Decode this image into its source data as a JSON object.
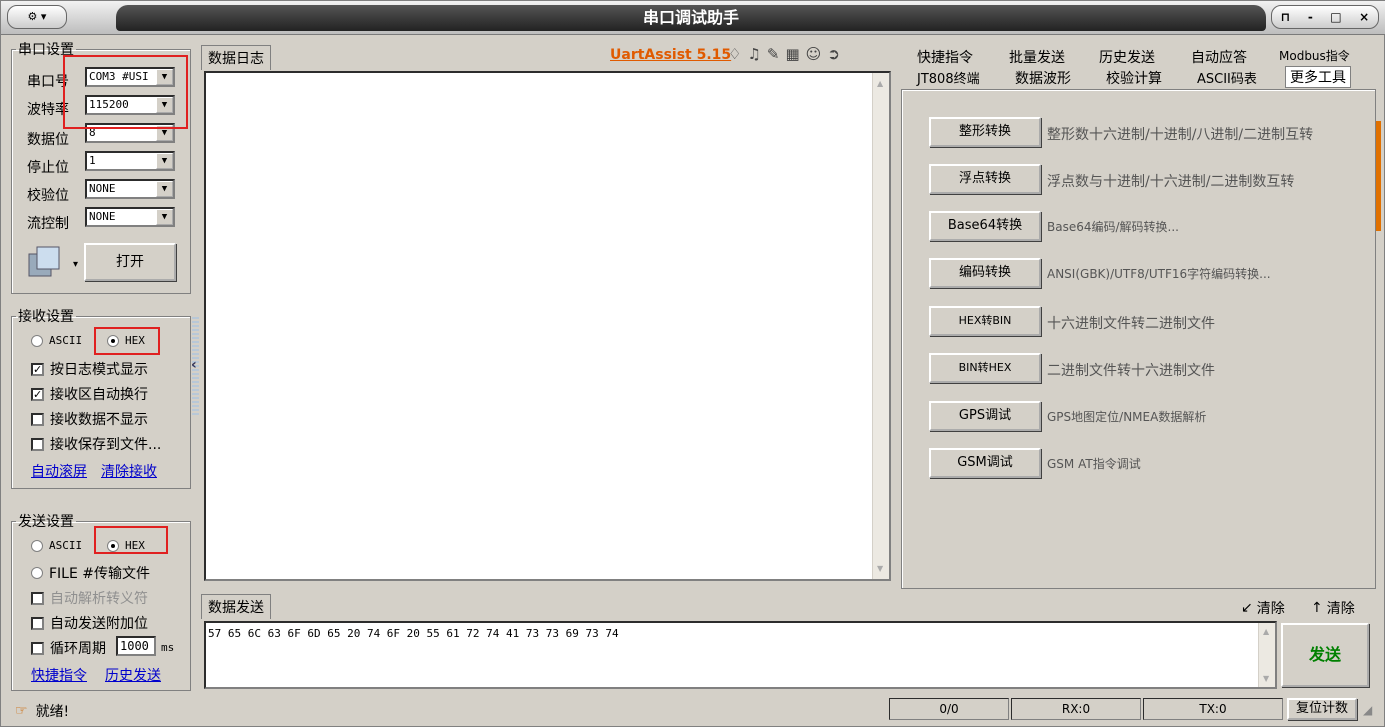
{
  "window": {
    "title": "串口调试助手",
    "controls": [
      "-",
      "□",
      "×"
    ]
  },
  "serial_settings": {
    "legend": "串口设置",
    "port_label": "串口号",
    "port_value": "COM3 #USI",
    "baud_label": "波特率",
    "baud_value": "115200",
    "databits_label": "数据位",
    "databits_value": "8",
    "stopbits_label": "停止位",
    "stopbits_value": "1",
    "parity_label": "校验位",
    "parity_value": "NONE",
    "flow_label": "流控制",
    "flow_value": "NONE",
    "open_button": "打开"
  },
  "receive_settings": {
    "legend": "接收设置",
    "ascii": "ASCII",
    "hex": "HEX",
    "log_mode": "按日志模式显示",
    "auto_wrap": "接收区自动换行",
    "no_display": "接收数据不显示",
    "save_file": "接收保存到文件...",
    "auto_scroll": "自动滚屏",
    "clear_receive": "清除接收"
  },
  "send_settings": {
    "legend": "发送设置",
    "ascii": "ASCII",
    "hex": "HEX",
    "file": "FILE #传输文件",
    "parse_escape": "自动解析转义符",
    "auto_append": "自动发送附加位",
    "loop_label": "循环周期",
    "loop_value": "1000",
    "loop_unit": "ms",
    "shortcut_link": "快捷指令",
    "history_link": "历史发送"
  },
  "log": {
    "tab": "数据日志",
    "brand": "UartAssist 5.15"
  },
  "send_area": {
    "tab": "数据发送",
    "content": "57 65 6C 63 6F 6D 65 20 74 6F 20 55 61 72 74 41 73 73 69 73 74",
    "clear1": "清除",
    "clear2": "清除",
    "send_button": "发送"
  },
  "right_tabs": {
    "row1": [
      "快捷指令",
      "批量发送",
      "历史发送",
      "自动应答",
      "Modbus指令"
    ],
    "row2": [
      "JT808终端",
      "数据波形",
      "校验计算",
      "ASCII码表",
      "更多工具"
    ]
  },
  "tools": [
    {
      "button": "整形转换",
      "desc": "整形数十六进制/十进制/八进制/二进制互转"
    },
    {
      "button": "浮点转换",
      "desc": "浮点数与十进制/十六进制/二进制数互转"
    },
    {
      "button": "Base64转换",
      "desc": "Base64编码/解码转换..."
    },
    {
      "button": "编码转换",
      "desc": "ANSI(GBK)/UTF8/UTF16字符编码转换..."
    },
    {
      "button": "HEX转BIN",
      "desc": "十六进制文件转二进制文件"
    },
    {
      "button": "BIN转HEX",
      "desc": "二进制文件转十六进制文件"
    },
    {
      "button": "GPS调试",
      "desc": "GPS地图定位/NMEA数据解析"
    },
    {
      "button": "GSM调试",
      "desc": "GSM AT指令调试"
    }
  ],
  "status": {
    "ready": "就绪!",
    "count": "0/0",
    "rx": "RX:0",
    "tx": "TX:0",
    "reset": "复位计数"
  }
}
